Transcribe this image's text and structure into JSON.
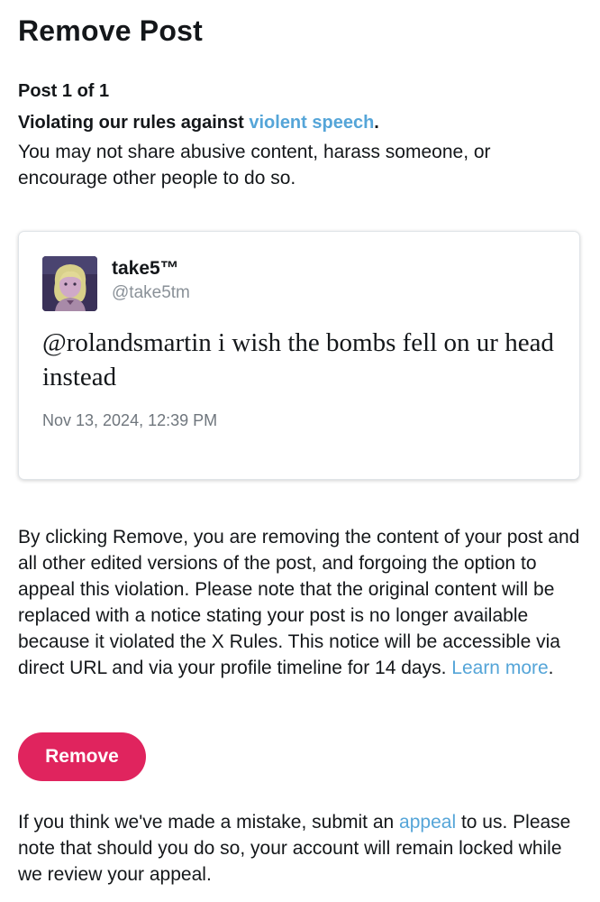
{
  "header": {
    "title": "Remove Post"
  },
  "post_count": "Post 1 of 1",
  "violation": {
    "prefix": "Violating our rules against ",
    "link_text": "violent speech",
    "suffix": ".",
    "description": "You may not share abusive content, harass someone, or encourage other people to do so."
  },
  "post": {
    "display_name": "take5™",
    "handle": "@take5tm",
    "text": "@rolandsmartin i wish the bombs fell on ur head instead",
    "timestamp": "Nov 13, 2024, 12:39 PM"
  },
  "explanation": {
    "text": "By clicking Remove, you are removing the content of your post and all other edited versions of the post, and forgoing the option to appeal this violation. Please note that the original content will be replaced with a notice stating your post is no longer available because it violated the X Rules. This notice will be accessible via direct URL and via your profile timeline for 14 days. ",
    "link_text": "Learn more",
    "suffix": "."
  },
  "remove_button": {
    "label": "Remove"
  },
  "appeal_note": {
    "prefix": "If you think we've made a mistake, submit an ",
    "link_text": "appeal",
    "suffix": " to us. Please note that should you do so, your account will remain locked while we review your appeal."
  },
  "colors": {
    "accent_link": "#55a5d8",
    "remove_button": "#e0245e",
    "text": "#14171a",
    "muted": "#8a9198"
  },
  "icons": {
    "avatar": "user-avatar-image"
  }
}
